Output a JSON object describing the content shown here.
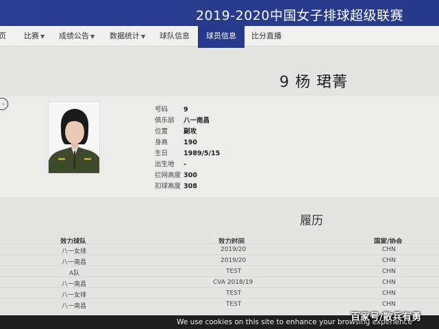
{
  "banner": {
    "title": "2019-2020中国女子排球超级联赛"
  },
  "nav": {
    "items": [
      {
        "label": "页",
        "caret": ""
      },
      {
        "label": "比赛",
        "caret": "▼"
      },
      {
        "label": "成绩公告",
        "caret": "▼"
      },
      {
        "label": "数据统计",
        "caret": "▼"
      },
      {
        "label": "球队信息",
        "caret": ""
      },
      {
        "label": "球员信息",
        "caret": ""
      },
      {
        "label": "比分直播",
        "caret": ""
      }
    ]
  },
  "player": {
    "name": "9 杨 珺菁",
    "fields": [
      {
        "label": "号码",
        "value": "9"
      },
      {
        "label": "俱乐部",
        "value": "八一南昌"
      },
      {
        "label": "位置",
        "value": "副攻"
      },
      {
        "label": "身高",
        "value": "190"
      },
      {
        "label": "生日",
        "value": "1989/5/15"
      },
      {
        "label": "出生地",
        "value": "-"
      },
      {
        "label": "拦网高度",
        "value": "300"
      },
      {
        "label": "扣球高度",
        "value": "308"
      }
    ]
  },
  "resume": {
    "title": "履历",
    "headers": {
      "team": "效力球队",
      "period": "效力时间",
      "country": "国家/协会"
    },
    "rows": [
      {
        "team": "八一女排",
        "period": "2019/20",
        "country": "CHN"
      },
      {
        "team": "八一南昌",
        "period": "2019/20",
        "country": "CHN"
      },
      {
        "team": "A队",
        "period": "TEST",
        "country": "CHN"
      },
      {
        "team": "八一南昌",
        "period": "CVA 2018/19",
        "country": "CHN"
      },
      {
        "team": "八一女排",
        "period": "TEST",
        "country": "CHN"
      },
      {
        "team": "八一南昌",
        "period": "TEST",
        "country": "CHN"
      }
    ]
  },
  "cookie": {
    "text": "We use cookies on this site to enhance your browsing experience"
  },
  "watermark": {
    "text": "百家号/散兵有勇"
  },
  "colors": {
    "banner": "#27398a",
    "active_tab": "#26398c",
    "cookie_bar": "#1e1e1e"
  }
}
